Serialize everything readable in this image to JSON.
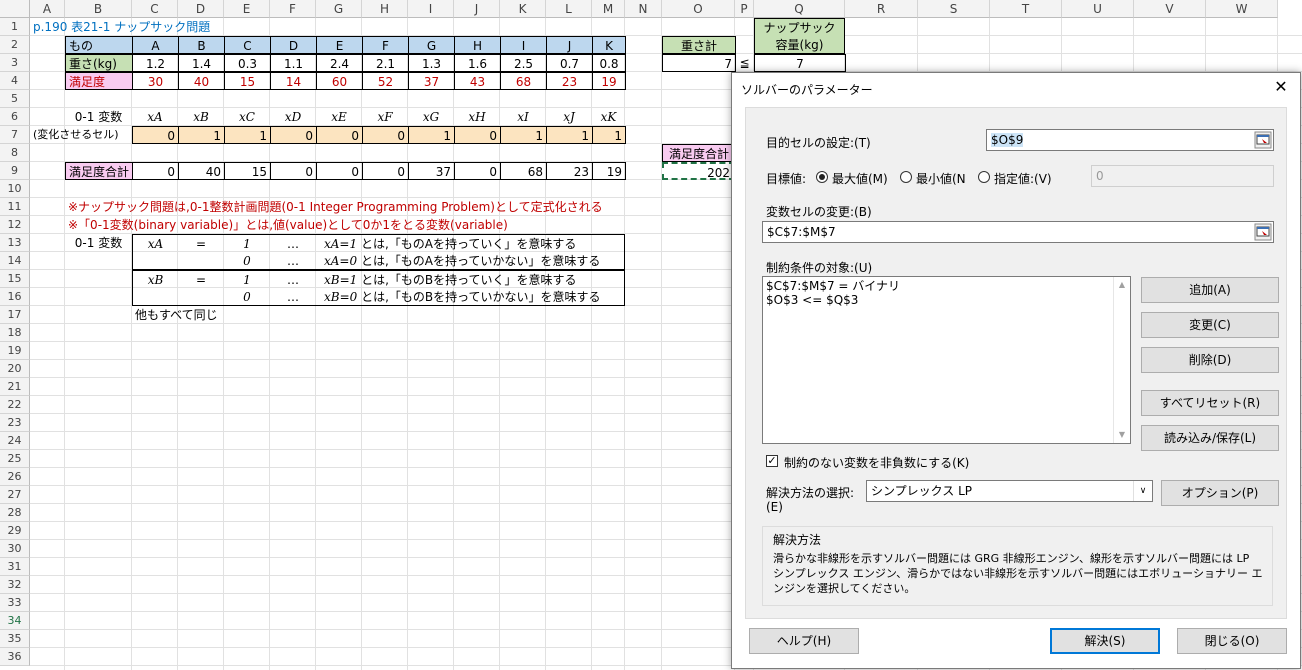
{
  "sheet": {
    "columns": [
      "A",
      "B",
      "C",
      "D",
      "E",
      "F",
      "G",
      "H",
      "I",
      "J",
      "K",
      "L",
      "M",
      "N",
      "O",
      "P",
      "Q",
      "R",
      "S",
      "T",
      "U",
      "V",
      "W"
    ],
    "rows": [
      "1",
      "2",
      "3",
      "4",
      "5",
      "6",
      "7",
      "8",
      "9",
      "10",
      "11",
      "12",
      "13",
      "14",
      "15",
      "16",
      "17",
      "18",
      "19",
      "20",
      "21",
      "22",
      "23",
      "24",
      "25",
      "26",
      "27",
      "28",
      "29",
      "30",
      "31",
      "32",
      "33",
      "34",
      "35",
      "36"
    ],
    "title": "p.190 表21-1 ナップサック問題",
    "row2_label": "もの",
    "items": [
      "A",
      "B",
      "C",
      "D",
      "E",
      "F",
      "G",
      "H",
      "I",
      "J",
      "K"
    ],
    "weight_label": "重さ(kg)",
    "weights": [
      "1.2",
      "1.4",
      "0.3",
      "1.1",
      "2.4",
      "2.1",
      "1.3",
      "1.6",
      "2.5",
      "0.7",
      "0.8"
    ],
    "satisfaction_label": "満足度",
    "satisfaction": [
      "30",
      "40",
      "15",
      "14",
      "60",
      "52",
      "37",
      "43",
      "68",
      "23",
      "19"
    ],
    "var_label": "0-1 変数",
    "var_names": [
      "xA",
      "xB",
      "xC",
      "xD",
      "xE",
      "xF",
      "xG",
      "xH",
      "xI",
      "xJ",
      "xK"
    ],
    "changing_label": "(変化させるセル)",
    "vars": [
      "0",
      "1",
      "1",
      "0",
      "0",
      "0",
      "1",
      "0",
      "1",
      "1",
      "1"
    ],
    "sat_total_label": "満足度合計",
    "sat_total_header": "満足度合計",
    "sat_row": [
      "0",
      "40",
      "15",
      "0",
      "0",
      "0",
      "37",
      "0",
      "68",
      "23",
      "19"
    ],
    "sat_total": "202",
    "weight_total_label": "重さ計",
    "weight_total": "7",
    "leq": "≦",
    "capacity_label_1": "ナップサック",
    "capacity_label_2": "容量(kg)",
    "capacity": "7",
    "note1": "※ナップサック問題は,0-1整数計画問題(0-1 Integer Programming Problem)として定式化される",
    "note2": "※「0-1変数(binary variable)」とは,値(value)として0か1をとる変数(variable)",
    "def_label": "0-1 変数",
    "def_rows": [
      {
        "var": "xA",
        "eq": "=",
        "val": "1",
        "dots": "…",
        "desc_var": "xA=1",
        "desc": "とは,「ものAを持っていく」を意味する"
      },
      {
        "var": "",
        "eq": "",
        "val": "0",
        "dots": "…",
        "desc_var": "xA=0",
        "desc": "とは,「ものAを持っていかない」を意味する"
      },
      {
        "var": "xB",
        "eq": "=",
        "val": "1",
        "dots": "…",
        "desc_var": "xB=1",
        "desc": "とは,「ものBを持っていく」を意味する"
      },
      {
        "var": "",
        "eq": "",
        "val": "0",
        "dots": "…",
        "desc_var": "xB=0",
        "desc": "とは,「ものBを持っていかない」を意味する"
      }
    ],
    "others_same": "他もすべて同じ"
  },
  "dialog": {
    "title": "ソルバーのパラメーター",
    "close": "✕",
    "objective_label": "目的セルの設定:(T)",
    "objective_value": "$O$9",
    "goal_label": "目標値:",
    "radio_max": "最大値(M)",
    "radio_min": "最小値(N",
    "radio_value": "指定値:(V)",
    "value_of": "0",
    "changing_label": "変数セルの変更:(B)",
    "changing_value": "$C$7:$M$7",
    "constraints_label": "制約条件の対象:(U)",
    "constraints": [
      "$C$7:$M$7 = バイナリ",
      "$O$3 <= $Q$3"
    ],
    "btn_add": "追加(A)",
    "btn_change": "変更(C)",
    "btn_delete": "削除(D)",
    "btn_reset": "すべてリセット(R)",
    "btn_load": "読み込み/保存(L)",
    "nonneg_label": "制約のない変数を非負数にする(K)",
    "method_label_1": "解決方法の選択:",
    "method_label_2": "(E)",
    "method_value": "シンプレックス LP",
    "btn_options": "オプション(P)",
    "desc_title": "解決方法",
    "desc_text": "滑らかな非線形を示すソルバー問題には GRG 非線形エンジン、線形を示すソルバー問題には LP シンプレックス エンジン、滑らかではない非線形を示すソルバー問題にはエボリューショナリー エンジンを選択してください。",
    "btn_help": "ヘルプ(H)",
    "btn_solve": "解決(S)",
    "btn_close": "閉じる(O)"
  }
}
